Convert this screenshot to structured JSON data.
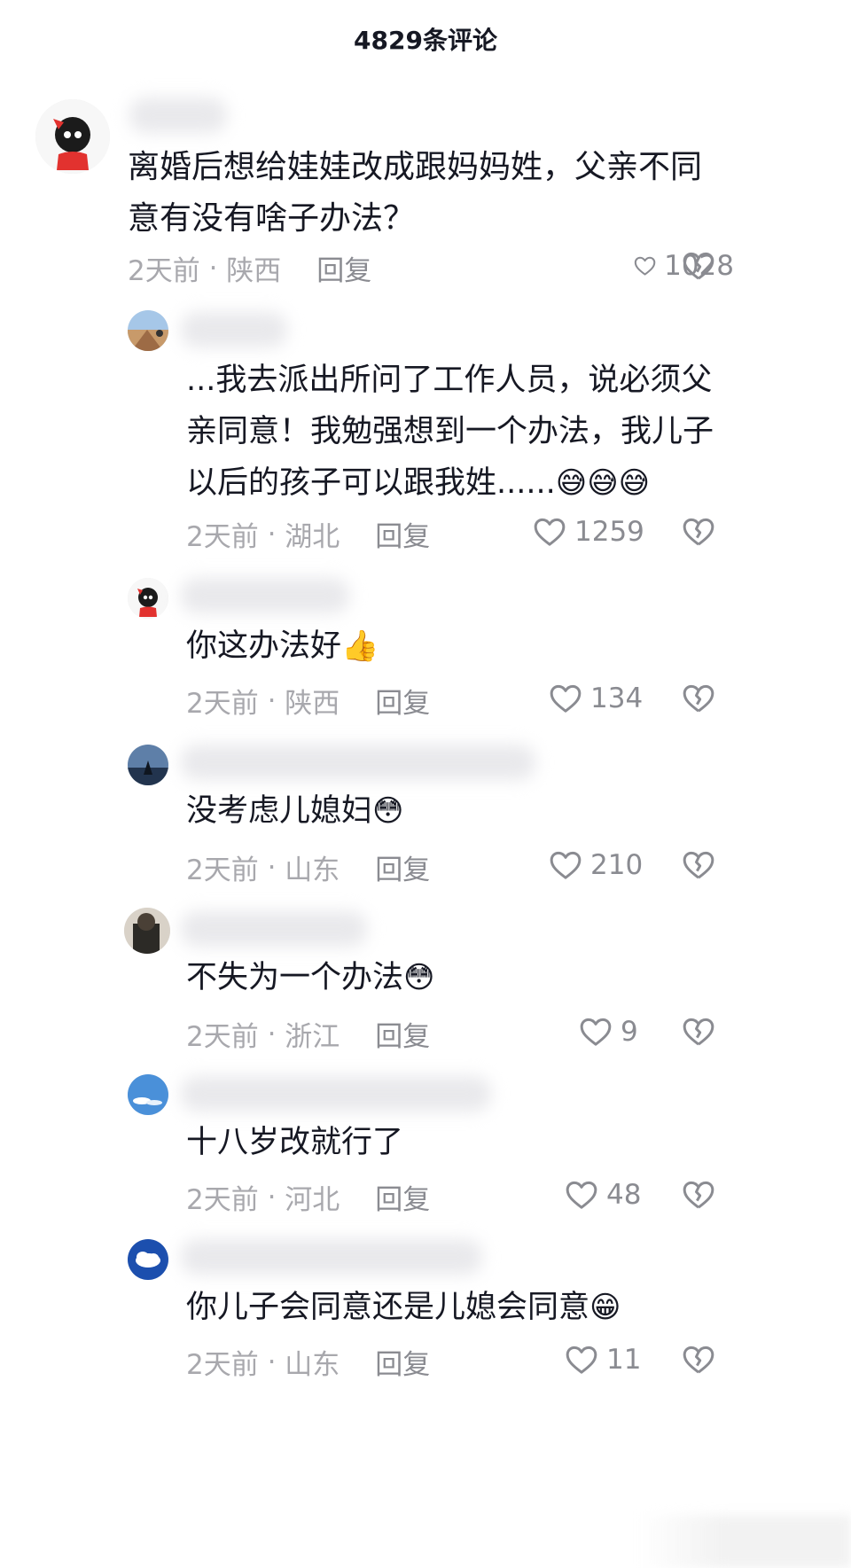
{
  "header": {
    "title": "4829条评论"
  },
  "icons": {
    "like": "heart-outline-icon",
    "dislike": "broken-heart-icon"
  },
  "comments": [
    {
      "text": "离婚后想给娃娃改成跟妈妈姓，父亲不同\n意有没有啥子办法？",
      "time": "2天前",
      "location": "陕西",
      "reply": "回复",
      "likes": "1028"
    },
    {
      "text": "...我去派出所问了工作人员，说必须父\n亲同意！我勉强想到一个办法，我儿子\n以后的孩子可以跟我姓......",
      "emoji": "😅😅😅",
      "time": "2天前",
      "location": "湖北",
      "reply": "回复",
      "likes": "1259"
    },
    {
      "text": "你这办法好",
      "emoji": "👍",
      "time": "2天前",
      "location": "陕西",
      "reply": "回复",
      "likes": "134"
    },
    {
      "text": "没考虑儿媳妇",
      "emoji": "😳",
      "time": "2天前",
      "location": "山东",
      "reply": "回复",
      "likes": "210"
    },
    {
      "text": "不失为一个办法",
      "emoji": "😳",
      "time": "2天前",
      "location": "浙江",
      "reply": "回复",
      "likes": "9"
    },
    {
      "text": "十八岁改就行了",
      "time": "2天前",
      "location": "河北",
      "reply": "回复",
      "likes": "48"
    },
    {
      "text": "你儿子会同意还是儿媳会同意",
      "emoji": "😁",
      "time": "2天前",
      "location": "山东",
      "reply": "回复",
      "likes": "11"
    }
  ]
}
